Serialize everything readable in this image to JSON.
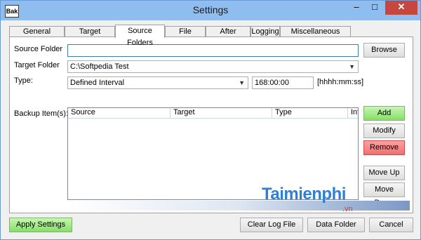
{
  "window": {
    "title": "Settings",
    "icon_text": "Bak",
    "controls": {
      "minimize": "–",
      "maximize": "□",
      "close": "✕"
    }
  },
  "tabs": [
    {
      "label": "General Settings"
    },
    {
      "label": "Target Folders"
    },
    {
      "label": "Source Folders",
      "active": true
    },
    {
      "label": "File Filtering"
    },
    {
      "label": "After Backup"
    },
    {
      "label": "Logging"
    },
    {
      "label": "Miscellaneous Settings"
    }
  ],
  "form": {
    "source_folder_label": "Source Folder",
    "source_folder_value": "",
    "target_folder_label": "Target Folder",
    "target_folder_value": "C:\\Softpedia Test",
    "type_label": "Type:",
    "type_value": "Defined Interval",
    "interval_value": "168:00:00",
    "interval_hint": "[hhhh:mm:ss]",
    "browse_label": "Browse"
  },
  "backup_items": {
    "label": "Backup Item(s):",
    "columns": [
      "Source",
      "Target",
      "Type",
      "Int"
    ],
    "rows": []
  },
  "side_buttons": {
    "add": "Add",
    "modify": "Modify",
    "remove": "Remove",
    "move_up": "Move Up",
    "move_down": "Move Down"
  },
  "bottom_buttons": {
    "apply": "Apply Settings",
    "clear_log": "Clear Log File",
    "data_folder": "Data Folder",
    "cancel": "Cancel"
  },
  "watermark": {
    "logo": "Taimienphi",
    "suffix": ".vn"
  },
  "colors": {
    "add_button": "#86df68",
    "remove_button": "#f17070",
    "titlebar": "#8fbdf0",
    "close_button": "#c7463f"
  }
}
